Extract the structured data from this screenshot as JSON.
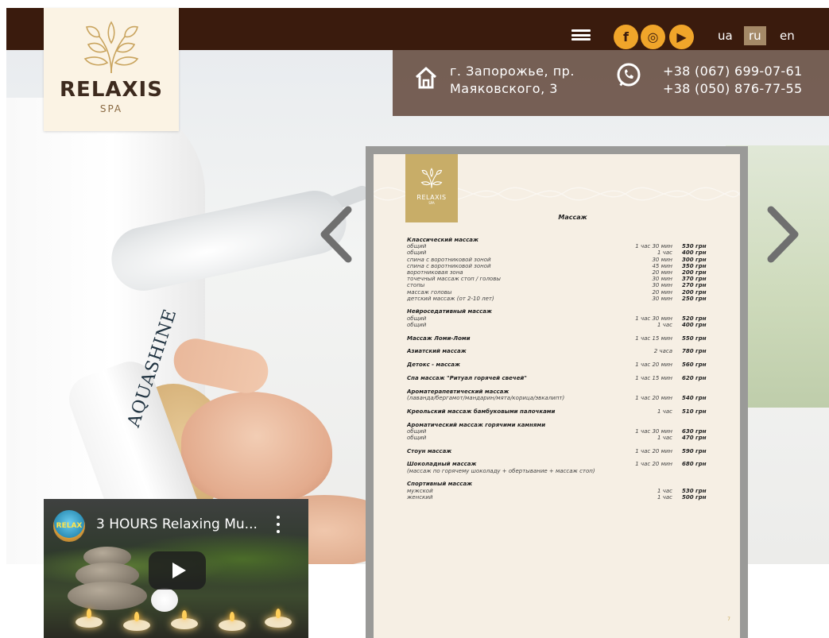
{
  "brand": {
    "name": "RELAXIS",
    "sub": "SPA"
  },
  "nav": {
    "social": [
      {
        "name": "facebook-icon",
        "glyph": "f"
      },
      {
        "name": "instagram-icon",
        "glyph": "◎"
      },
      {
        "name": "youtube-icon",
        "glyph": "▶"
      }
    ],
    "languages": [
      {
        "code": "ua",
        "active": false
      },
      {
        "code": "ru",
        "active": true
      },
      {
        "code": "en",
        "active": false
      }
    ]
  },
  "contact": {
    "address_line1": "г. Запорожье, пр.",
    "address_line2": "Маяковского, 3",
    "phone1": "+38 (067) 699-07-61",
    "phone2": "+38 (050) 876-77-55"
  },
  "hero": {
    "towel_text": "AQUASHINE"
  },
  "menu_doc": {
    "logo_name": "RELAXIS",
    "logo_sub": "SPA",
    "title": "Массаж",
    "page_number": "7",
    "rows": [
      {
        "name": "Классический массаж",
        "dur": "",
        "price": "",
        "head": true
      },
      {
        "name": "общий",
        "dur": "1 час 30 мин",
        "price": "530 грн"
      },
      {
        "name": "общий",
        "dur": "1 час",
        "price": "400 грн"
      },
      {
        "name": "спина с воротниковой зоной",
        "dur": "30 мин",
        "price": "300 грн"
      },
      {
        "name": "спина с воротниковой зоной",
        "dur": "45 мин",
        "price": "350 грн"
      },
      {
        "name": "воротниковая зона",
        "dur": "20 мин",
        "price": "200 грн"
      },
      {
        "name": "точечный массаж стоп / головы",
        "dur": "30 мин",
        "price": "370 грн"
      },
      {
        "name": "стопы",
        "dur": "30 мин",
        "price": "270 грн"
      },
      {
        "name": "массаж головы",
        "dur": "20 мин",
        "price": "200 грн"
      },
      {
        "name": "детский массаж (от 2-10 лет)",
        "dur": "30 мин",
        "price": "250 грн"
      },
      {
        "gap": true
      },
      {
        "name": "Нейроседативный массаж",
        "dur": "",
        "price": "",
        "head": true
      },
      {
        "name": "общий",
        "dur": "1 час 30 мин",
        "price": "520 грн"
      },
      {
        "name": "общий",
        "dur": "1 час",
        "price": "400 грн"
      },
      {
        "gap": true
      },
      {
        "name": "Массаж Ломи-Ломи",
        "dur": "1 час 15 мин",
        "price": "550 грн",
        "head": true
      },
      {
        "gap": true
      },
      {
        "name": "Азиатский массаж",
        "dur": "2 часа",
        "price": "780 грн",
        "head": true
      },
      {
        "gap": true
      },
      {
        "name": "Детокс - массаж",
        "dur": "1 час 20 мин",
        "price": "560 грн",
        "head": true
      },
      {
        "gap": true
      },
      {
        "name": "Спа массаж \"Ритуал горячей свечей\"",
        "dur": "1 час 15 мин",
        "price": "620 грн",
        "head": true
      },
      {
        "gap": true
      },
      {
        "name": "Ароматерапевтический массаж",
        "dur": "",
        "price": "",
        "head": true
      },
      {
        "name": "(лаванда/бергамот/мандарин/мята/корица/эвкалипт)",
        "dur": "1 час 20 мин",
        "price": "540 грн"
      },
      {
        "gap": true
      },
      {
        "name": "Креольский массаж бамбуковыми палочками",
        "dur": "1 час",
        "price": "510 грн",
        "head": true
      },
      {
        "gap": true
      },
      {
        "name": "Ароматический массаж горячими камнями",
        "dur": "",
        "price": "",
        "head": true
      },
      {
        "name": "общий",
        "dur": "1 час 30 мин",
        "price": "630 грн"
      },
      {
        "name": "общий",
        "dur": "1 час",
        "price": "470 грн"
      },
      {
        "gap": true
      },
      {
        "name": "Стоун массаж",
        "dur": "1 час 20 мин",
        "price": "590 грн",
        "head": true
      },
      {
        "gap": true
      },
      {
        "name": "Шоколадный массаж",
        "dur": "1 час 20 мин",
        "price": "680 грн",
        "head": true
      },
      {
        "name": "(массаж по горячему шоколаду + обертывание + массаж стоп)",
        "dur": "",
        "price": ""
      },
      {
        "gap": true
      },
      {
        "name": "Спортивный массаж",
        "dur": "",
        "price": "",
        "head": true
      },
      {
        "name": "мужской",
        "dur": "1 час",
        "price": "530 грн"
      },
      {
        "name": "женский",
        "dur": "1 час",
        "price": "500 грн"
      }
    ]
  },
  "video": {
    "title": "3 HOURS Relaxing Mu...",
    "channel_badge": "RELAX"
  },
  "colors": {
    "topbar": "#3a1b0d",
    "accent": "#f0a52a",
    "lang_active": "#a48967"
  }
}
